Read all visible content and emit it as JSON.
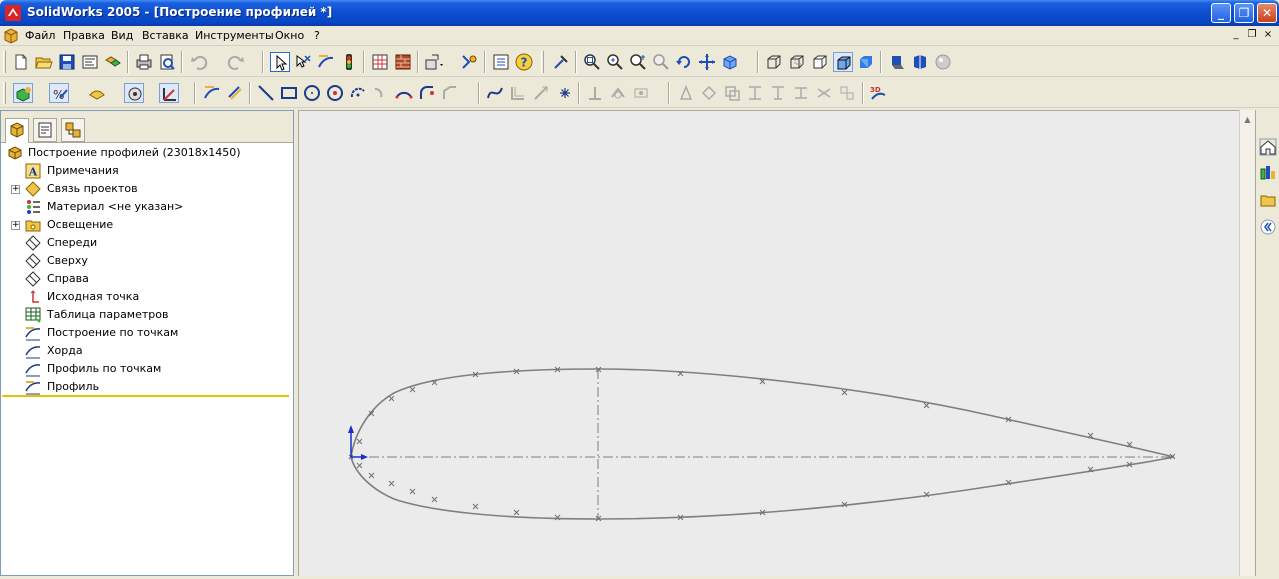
{
  "window": {
    "title": "SolidWorks 2005 - [Построение профилей *]",
    "minimize": "_",
    "maximize": "❐",
    "close": "✕"
  },
  "menu": [
    "Файл",
    "Правка",
    "Вид",
    "Вставка",
    "Инструменты",
    "Окно",
    "?"
  ],
  "mdi_controls": [
    "_",
    "❐",
    "×"
  ],
  "feature_tree": {
    "root": "Построение профилей  (23018x1450)",
    "items": [
      {
        "label": "Примечания",
        "icon": "annotations-icon",
        "expandable": false
      },
      {
        "label": "Связь проектов",
        "icon": "design-binder-icon",
        "expandable": true
      },
      {
        "label": "Материал <не указан>",
        "icon": "material-icon",
        "expandable": false
      },
      {
        "label": "Освещение",
        "icon": "lighting-folder-icon",
        "expandable": true
      },
      {
        "label": "Спереди",
        "icon": "plane-icon",
        "expandable": false
      },
      {
        "label": "Сверху",
        "icon": "plane-icon",
        "expandable": false
      },
      {
        "label": "Справа",
        "icon": "plane-icon",
        "expandable": false
      },
      {
        "label": "Исходная точка",
        "icon": "origin-icon",
        "expandable": false
      },
      {
        "label": "Таблица параметров",
        "icon": "design-table-icon",
        "expandable": false
      },
      {
        "label": "Построение по точкам",
        "icon": "sketch-icon",
        "expandable": false
      },
      {
        "label": "Хорда",
        "icon": "sketch-icon",
        "expandable": false
      },
      {
        "label": "Профиль по точкам",
        "icon": "sketch-icon",
        "expandable": false
      },
      {
        "label": "Профиль",
        "icon": "sketch-icon",
        "expandable": false
      }
    ]
  },
  "colors": {
    "titlebar": "#0a46c4",
    "profile_curve": "#7f7f7f",
    "canvas_bg": "#ebebeb",
    "tree_highlight_line": "#e4c300",
    "origin_axis": "#1a2ec8"
  }
}
